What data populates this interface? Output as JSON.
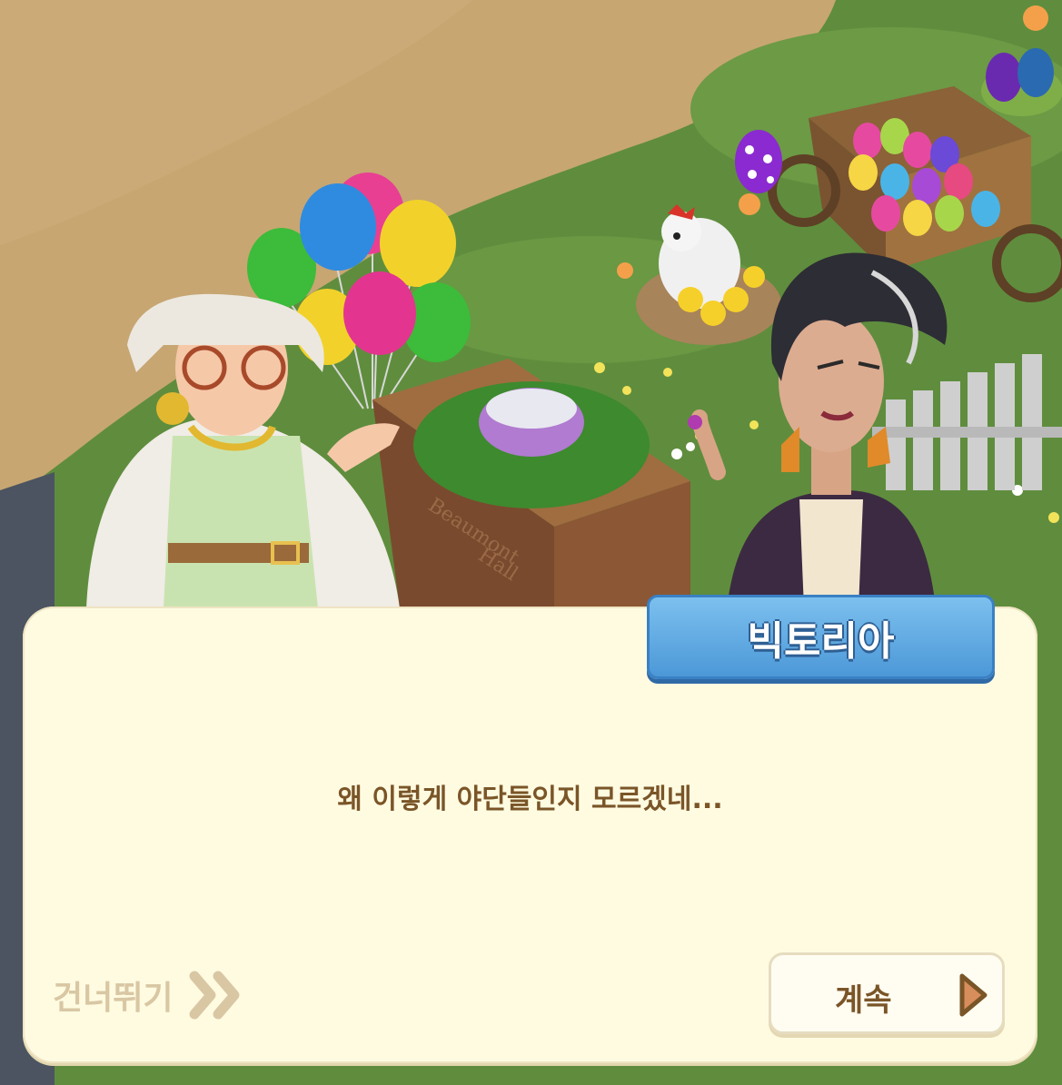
{
  "dialog": {
    "speaker_name": "빅토리아",
    "message": "왜 이렇게 야단들인지 모르겠네...",
    "skip_label": "건너뛰기",
    "continue_label": "계속"
  },
  "scene": {
    "sign_text_line1": "Beaumont",
    "sign_text_line2": "Hall"
  },
  "icons": {
    "skip": "double-chevron-right-icon",
    "continue": "play-triangle-icon"
  },
  "colors": {
    "dialog_bg": "#fffbe1",
    "name_tag": "#5aa6e2",
    "text_brown": "#7a5528",
    "skip_text": "#d9c7a4"
  }
}
